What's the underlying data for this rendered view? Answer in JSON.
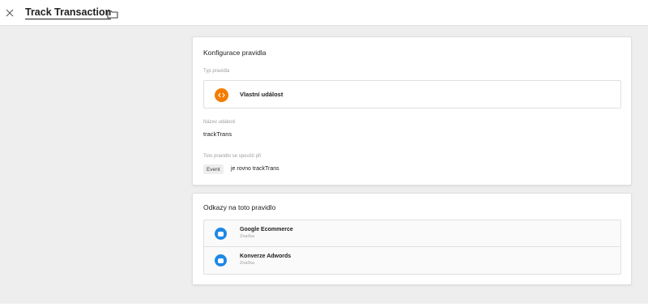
{
  "header": {
    "title": "Track Transaction"
  },
  "trigger_config": {
    "section_title": "Konfigurace pravidla",
    "type_label": "Typ pravidla",
    "type_value": "Vlastní událost",
    "type_color": "#f57c00",
    "event_name_label": "Název události",
    "event_name_value": "trackTrans",
    "fires_on_label": "Toto pravidlo se spouští při",
    "condition_variable": "Event",
    "condition_text": "je rovno trackTrans"
  },
  "references": {
    "section_title": "Odkazy na toto pravidlo",
    "icon_color": "#1e88e5",
    "items": [
      {
        "name": "Google Ecommerce",
        "kind": "Značka"
      },
      {
        "name": "Konverze Adwords",
        "kind": "Značka"
      }
    ]
  }
}
